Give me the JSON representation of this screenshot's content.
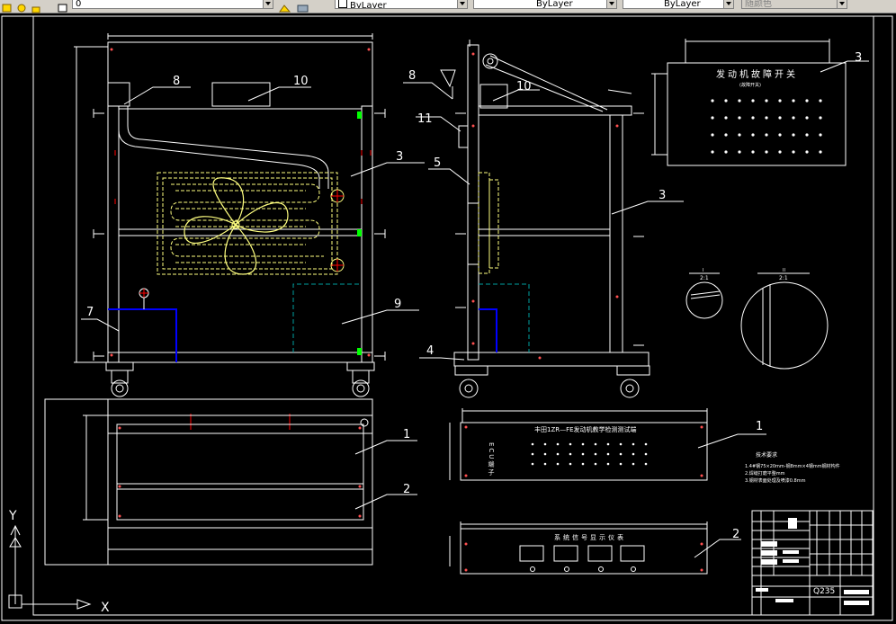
{
  "toolbar": {
    "layer_value": "0",
    "color_value": "ByLayer",
    "linetype_value": "ByLayer",
    "lineweight_value": "ByLayer",
    "plotstyle_value": "随颜色"
  },
  "drawing": {
    "part_labels": {
      "front_8": "8",
      "front_10": "10",
      "front_3": "3",
      "front_7": "7",
      "front_9": "9",
      "side_8": "8",
      "side_10": "10",
      "side_11": "11",
      "side_5": "5",
      "side_3": "3",
      "side_4": "4",
      "panel_3": "3",
      "top_1": "1",
      "top_2": "2",
      "ecu_1": "1",
      "signal_2": "2"
    },
    "switch_panel_title": "发动机故障开关",
    "switch_panel_subtitle": "(故障开关)",
    "ecu_panel_title": "丰田1ZR—FE发动机教学检测测试端",
    "ecu_vertical_label": "ECU端子",
    "signal_panel_title": "系统信号显示仪表",
    "detail_I_label": "I",
    "detail_I_scale": "2:1",
    "detail_II_label": "II",
    "detail_II_scale": "2:1",
    "tech_req_title": "技术要求",
    "tech_req_lines": [
      "1.4#钢75×20mm-钢8mm×4钢mm钢材构件",
      "2.焊缝打磨平整mm",
      "3.钢材表面处理及喷漆0.8mm"
    ],
    "material": "Q235",
    "ucs_x": "X",
    "ucs_y": "Y"
  },
  "colors": {
    "background": "#000000",
    "line": "#ffffff",
    "radiator": "#ffff80",
    "pipe_blue": "#0000ff",
    "tank_cyan": "#008080",
    "marker_red": "#ff0000",
    "marker_green": "#00ff00"
  }
}
